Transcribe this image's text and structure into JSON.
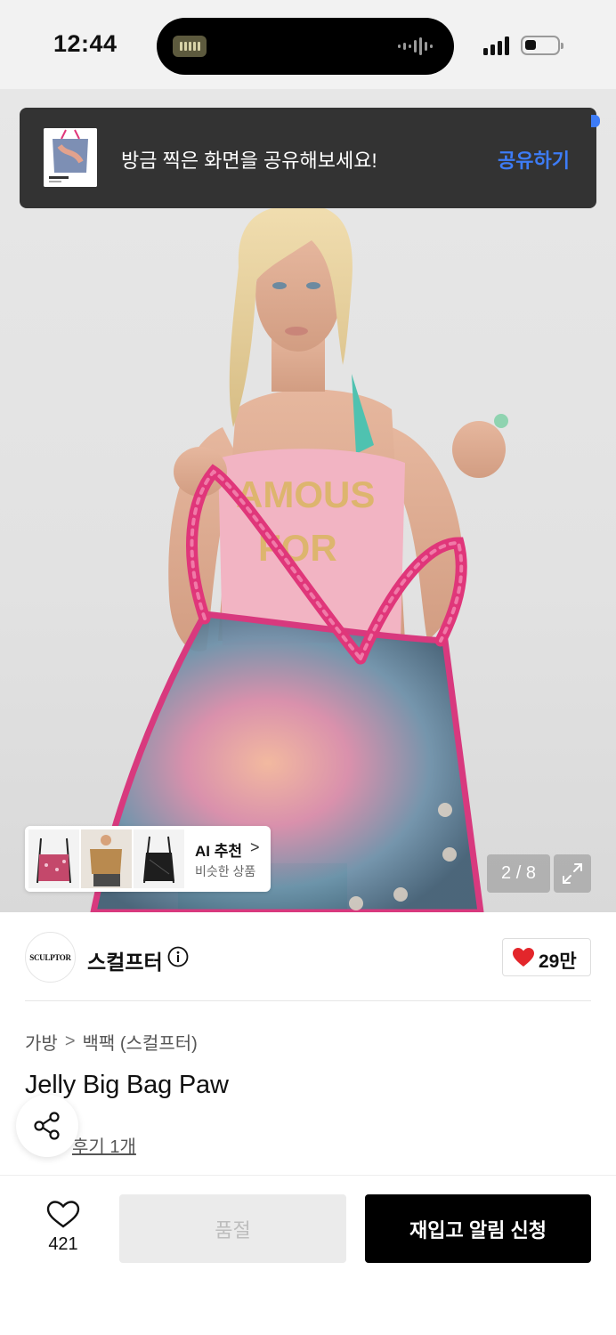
{
  "status_bar": {
    "time": "12:44"
  },
  "toast": {
    "message": "방금 찍은 화면을 공유해보세요!",
    "action_label": "공유하기"
  },
  "gallery": {
    "counter": "2 / 8",
    "ai_recommend": {
      "title": "AI 추천",
      "chevron": ">",
      "subtitle": "비슷한 상품"
    }
  },
  "brand": {
    "logo_text": "SCULPTOR",
    "name": "스컬프터",
    "like_count": "29만"
  },
  "product": {
    "breadcrumb": [
      "가방",
      "백팩 (스컬프터)"
    ],
    "breadcrumb_sep": ">",
    "title": "Jelly Big Bag Paw",
    "review_label": "후기 1개"
  },
  "bottom_bar": {
    "wish_count": "421",
    "soldout_label": "품절",
    "restock_label": "재입고 알림 신청"
  },
  "colors": {
    "accent_blue": "#3d7cf7",
    "heart_red": "#e3262b",
    "toast_bg": "#333333"
  }
}
